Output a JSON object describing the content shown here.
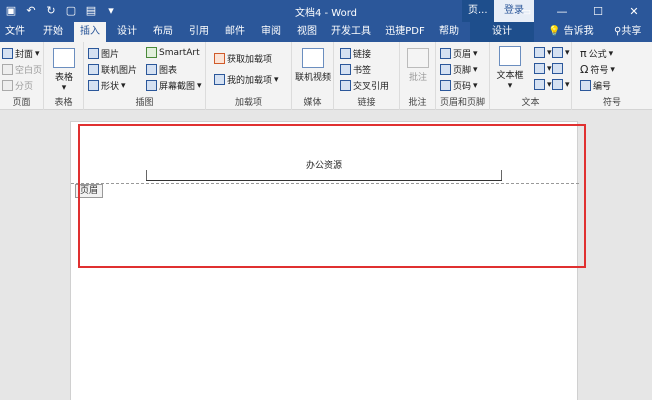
{
  "titlebar": {
    "doc_title": "文档4 - Word",
    "context_label": "页...",
    "login": "登录",
    "controls": [
      "▭",
      "—",
      "☐",
      "✕"
    ]
  },
  "tabs": [
    {
      "label": "文件",
      "state": "normal"
    },
    {
      "label": "开始",
      "state": "normal"
    },
    {
      "label": "插入",
      "state": "active"
    },
    {
      "label": "设计",
      "state": "normal"
    },
    {
      "label": "布局",
      "state": "normal"
    },
    {
      "label": "引用",
      "state": "normal"
    },
    {
      "label": "邮件",
      "state": "normal"
    },
    {
      "label": "审阅",
      "state": "normal"
    },
    {
      "label": "视图",
      "state": "normal"
    },
    {
      "label": "开发工具",
      "state": "normal"
    },
    {
      "label": "迅捷PDF",
      "state": "normal"
    },
    {
      "label": "帮助",
      "state": "normal"
    },
    {
      "label": "设计",
      "state": "context"
    }
  ],
  "tell_me": "告诉我",
  "share": "共享",
  "ribbon": {
    "pages": {
      "label": "页面",
      "items": [
        "封面",
        "空白页",
        "分页"
      ]
    },
    "tables": {
      "label": "表格",
      "item": "表格"
    },
    "illustrations": {
      "label": "插图",
      "items": [
        "图片",
        "SmartArt",
        "联机图片",
        "图表",
        "形状",
        "屏幕截图"
      ]
    },
    "addins": {
      "label": "加载项",
      "items": [
        "获取加载项",
        "我的加载项"
      ]
    },
    "media": {
      "label": "媒体",
      "item": "联机视频"
    },
    "links": {
      "label": "链接",
      "items": [
        "链接",
        "书签",
        "交叉引用"
      ]
    },
    "comments": {
      "label": "批注",
      "item": "批注"
    },
    "header_footer": {
      "label": "页眉和页脚",
      "items": [
        "页眉",
        "页脚",
        "页码"
      ]
    },
    "text": {
      "label": "文本",
      "item": "文本框"
    },
    "symbols": {
      "label": "符号",
      "items": [
        "公式",
        "符号",
        "编号"
      ]
    }
  },
  "document": {
    "header_text": "办公资源",
    "header_tag": "页眉"
  },
  "colors": {
    "accent": "#2b579a",
    "highlight_box": "#e03030"
  }
}
